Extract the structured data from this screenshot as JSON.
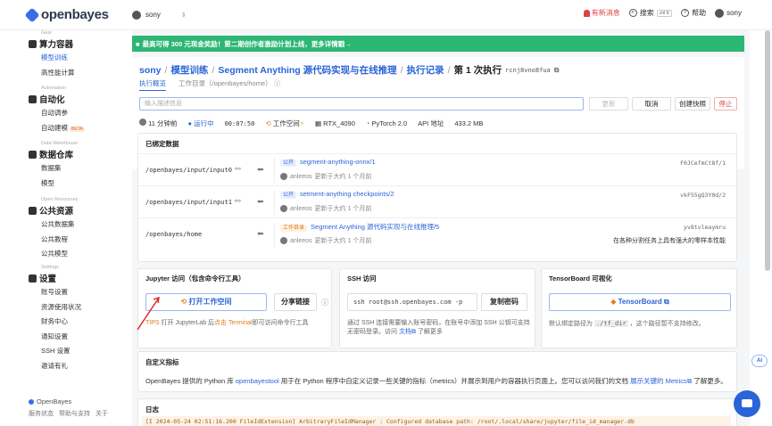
{
  "topbar": {
    "logo": "openbayes",
    "user": "sony",
    "news": "有新消息",
    "search": "搜索",
    "search_kbd": "ctrl K",
    "help": "帮助",
    "user_right": "sony"
  },
  "sidebar": {
    "sections": [
      {
        "caption": "Gear",
        "title": "算力容器",
        "items": [
          "模型训练",
          "高性能计算"
        ]
      },
      {
        "caption": "Automation",
        "title": "自动化",
        "items": [
          "自动调参",
          "自动建模"
        ]
      },
      {
        "caption": "Data Warehouse",
        "title": "数据仓库",
        "items": [
          "数据集",
          "模型"
        ]
      },
      {
        "caption": "Open Resources",
        "title": "公共资源",
        "items": [
          "公共数据集",
          "公共教程",
          "公共模型"
        ]
      },
      {
        "caption": "Settings",
        "title": "设置",
        "items": [
          "账号设置",
          "资源使用状况",
          "财务中心",
          "通知设置",
          "SSH 设置",
          "邀请有礼"
        ]
      }
    ],
    "beta": "BETA",
    "footer_brand": "OpenBayes",
    "footer_links": [
      "服务状态",
      "帮助与支持",
      "关于"
    ]
  },
  "banner": "最高可得 300 元现金奖励！第二期创作者激励计划上线，更多详情戳→",
  "header": {
    "crumbs": [
      "sony",
      "模型训练",
      "Segment Anything 源代码实现与在线推理",
      "执行记录"
    ],
    "current": "第 1 次执行",
    "hash": "rcnj8vno8fua",
    "tabs": [
      "执行概览",
      "工作目录（/openbayes/home）"
    ],
    "desc_placeholder": "输入描述信息",
    "btn_update": "更新",
    "btn_cancel": "取消",
    "btn_snapshot": "创建快照",
    "btn_stop": "停止"
  },
  "stats": {
    "age": "11 分钟前",
    "status": "运行中",
    "duration": "00:07:50",
    "workspace": "工作空间",
    "gpu": "RTX_4090",
    "framework": "PyTorch 2.0",
    "api": "API 地址",
    "size": "433.2 MB"
  },
  "bound": {
    "title": "已绑定数据",
    "rows": [
      {
        "path": "/openbayes/input/input0",
        "tag": "公开",
        "name": "segment-anything-onnx/1",
        "hash": "F0JCefmCt8f/1",
        "user": "anleeos",
        "time": "更新于大约 1 个月前",
        "note": ""
      },
      {
        "path": "/openbayes/input/input1",
        "tag": "公开",
        "name": "setment-anything checkpoints/2",
        "hash": "vkF55gQ3Y0d/2",
        "user": "anleeos",
        "time": "更新于大约 1 个月前",
        "note": ""
      },
      {
        "path": "/openbayes/home",
        "tag": "工作目录",
        "name": "Segment Anything 源代码实现与在线推理/5",
        "hash": "yv8tvleaymru",
        "user": "anleeos",
        "time": "更新于大约 1 个月前",
        "note": "在各种分割任务上具有强大的零样本性能"
      }
    ]
  },
  "jupyter": {
    "title": "Jupyter 访问（包含命令行工具）",
    "open": "打开工作空间",
    "share": "分享链接",
    "tips_label": "TIPS",
    "tips_a": "打开 JupyterLab 后",
    "tips_b": "点击 Terminal",
    "tips_c": "即可访问命令行工具"
  },
  "ssh": {
    "title": "SSH 访问",
    "command": "ssh root@ssh.openbayes.com -p",
    "copy": "复制密码",
    "tip": "通过 SSH 连接需要输入账号密码，在账号中添加 SSH 公钥可支持无密码登录。访问",
    "tip_link": "文档",
    "tip_end": "了解更多"
  },
  "tensorboard": {
    "title": "TensorBoard 可视化",
    "btn": "TensorBoard",
    "tip_a": "默认绑定路径为",
    "tip_code": "./tf_dir",
    "tip_b": "，这个路径暂不支持修改。"
  },
  "metrics": {
    "title": "自定义指标",
    "text_a": "OpenBayes 提供的 Python 库",
    "lib": "openbayestool",
    "text_b": "用于在 Python 程序中自定义记录一些关键的指标（metrics）并展示到用户的容器执行页面上。您可以访问我们的文档",
    "link": "展示关键的 Metrics",
    "text_c": "了解更多。"
  },
  "log": {
    "title": "日志",
    "line": "[I 2024-05-24 02:51:16.200 FileIdExtension] ArbitraryFileIdManager : Configured database path: /root/.local/share/jupyter/file_id_manager.db"
  },
  "ai": "AI"
}
